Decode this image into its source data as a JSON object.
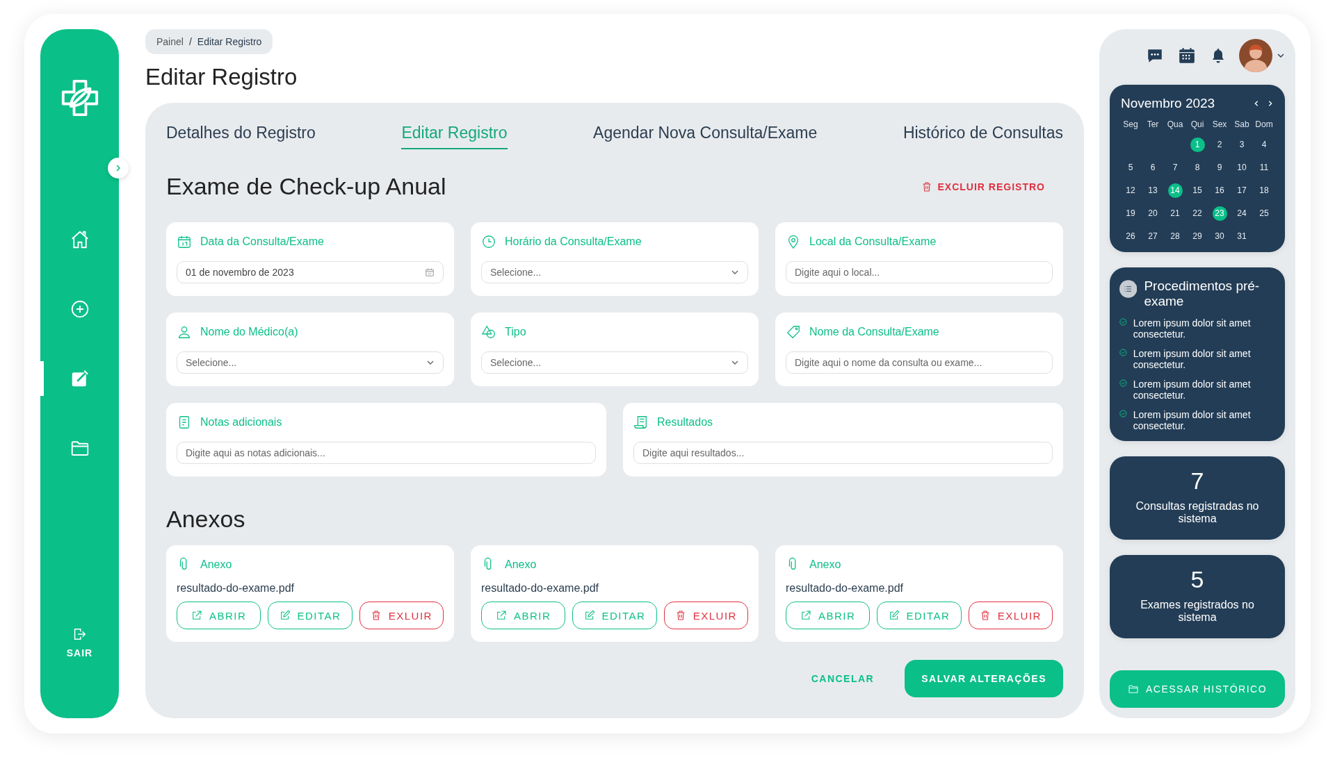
{
  "sidebar": {
    "nav": [
      {
        "kind": "home",
        "selected": false
      },
      {
        "kind": "add",
        "selected": false
      },
      {
        "kind": "edit",
        "selected": true
      },
      {
        "kind": "folder",
        "selected": false
      }
    ],
    "logout": "SAIR"
  },
  "breadcrumb": {
    "items": [
      "Painel",
      "Editar Registro"
    ],
    "separator": "/"
  },
  "title": "Editar Registro",
  "tabs": [
    {
      "label": "Detalhes do Registro",
      "selected": false
    },
    {
      "label": "Editar Registro",
      "selected": true
    },
    {
      "label": "Agendar Nova Consulta/Exame",
      "selected": false
    },
    {
      "label": "Histórico de Consultas",
      "selected": false
    }
  ],
  "record": {
    "title": "Exame de Check-up Anual",
    "delete": "EXCLUIR REGISTRO"
  },
  "field_rows": [
    [
      {
        "label": "Data da Consulta/Exame",
        "kind": "date",
        "value": "01 de novembro de 2023"
      },
      {
        "label": "Horário da Consulta/Exame",
        "kind": "select",
        "placeholder": "Selecione..."
      },
      {
        "label": "Local da Consulta/Exame",
        "kind": "text",
        "placeholder": "Digite aqui o local..."
      }
    ],
    [
      {
        "label": "Nome do Médico(a)",
        "kind": "select",
        "placeholder": "Selecione..."
      },
      {
        "label": "Tipo",
        "kind": "select",
        "placeholder": "Selecione..."
      },
      {
        "label": "Nome da Consulta/Exame",
        "kind": "text",
        "placeholder": "Digite aqui o nome da consulta ou exame..."
      }
    ],
    [
      {
        "label": "Notas adicionais",
        "kind": "text",
        "placeholder": "Digite aqui as notas adicionais..."
      },
      {
        "label": "Resultados",
        "kind": "text",
        "placeholder": "Digite aqui resultados..."
      }
    ]
  ],
  "attachments": {
    "title": "Anexos",
    "items": [
      {
        "label": "Anexo",
        "file": "resultado-do-exame.pdf",
        "actions": [
          {
            "kind": "open",
            "label": "ABRIR"
          },
          {
            "kind": "edit",
            "label": "EDITAR"
          },
          {
            "kind": "delete",
            "label": "EXLUIR"
          }
        ]
      },
      {
        "label": "Anexo",
        "file": "resultado-do-exame.pdf",
        "actions": [
          {
            "kind": "open",
            "label": "ABRIR"
          },
          {
            "kind": "edit",
            "label": "EDITAR"
          },
          {
            "kind": "delete",
            "label": "EXLUIR"
          }
        ]
      },
      {
        "label": "Anexo",
        "file": "resultado-do-exame.pdf",
        "actions": [
          {
            "kind": "open",
            "label": "ABRIR"
          },
          {
            "kind": "edit",
            "label": "EDITAR"
          },
          {
            "kind": "delete",
            "label": "EXLUIR"
          }
        ]
      }
    ]
  },
  "form_actions": {
    "cancel": "CANCELAR",
    "save": "SALVAR ALTERAÇÕES"
  },
  "calendar": {
    "title": "Novembro 2023",
    "weekdays": [
      "Seg",
      "Ter",
      "Qua",
      "Qui",
      "Sex",
      "Sab",
      "Dom"
    ],
    "weeks": [
      [
        {
          "day": "1",
          "selected": true
        },
        {
          "day": "2",
          "selected": false
        },
        {
          "day": "3",
          "selected": false
        },
        {
          "day": "4",
          "selected": false
        }
      ],
      [
        {
          "day": "5",
          "selected": false
        },
        {
          "day": "6",
          "selected": false
        },
        {
          "day": "7",
          "selected": false
        },
        {
          "day": "8",
          "selected": false
        },
        {
          "day": "9",
          "selected": false
        },
        {
          "day": "10",
          "selected": false
        },
        {
          "day": "11",
          "selected": false
        }
      ],
      [
        {
          "day": "12",
          "selected": false
        },
        {
          "day": "13",
          "selected": false
        },
        {
          "day": "14",
          "selected": true
        },
        {
          "day": "15",
          "selected": false
        },
        {
          "day": "16",
          "selected": false
        },
        {
          "day": "17",
          "selected": false
        },
        {
          "day": "18",
          "selected": false
        }
      ],
      [
        {
          "day": "19",
          "selected": false
        },
        {
          "day": "20",
          "selected": false
        },
        {
          "day": "21",
          "selected": false
        },
        {
          "day": "22",
          "selected": false
        },
        {
          "day": "23",
          "selected": true
        },
        {
          "day": "24",
          "selected": false
        },
        {
          "day": "25",
          "selected": false
        }
      ],
      [
        {
          "day": "26",
          "selected": false
        },
        {
          "day": "27",
          "selected": false
        },
        {
          "day": "28",
          "selected": false
        },
        {
          "day": "29",
          "selected": false
        },
        {
          "day": "30",
          "selected": false
        },
        {
          "day": "31",
          "selected": false
        }
      ]
    ]
  },
  "procedures": {
    "title": "Procedimentos pré-exame",
    "items": [
      "Lorem ipsum dolor sit amet consectetur.",
      "Lorem ipsum dolor sit amet consectetur.",
      "Lorem ipsum dolor sit amet consectetur.",
      "Lorem ipsum dolor sit amet consectetur."
    ]
  },
  "stats": [
    {
      "value": "7",
      "label": "Consultas registradas no sistema"
    },
    {
      "value": "5",
      "label": "Exames registrados no sistema"
    }
  ],
  "history_button": "ACESSAR HISTÓRICO"
}
